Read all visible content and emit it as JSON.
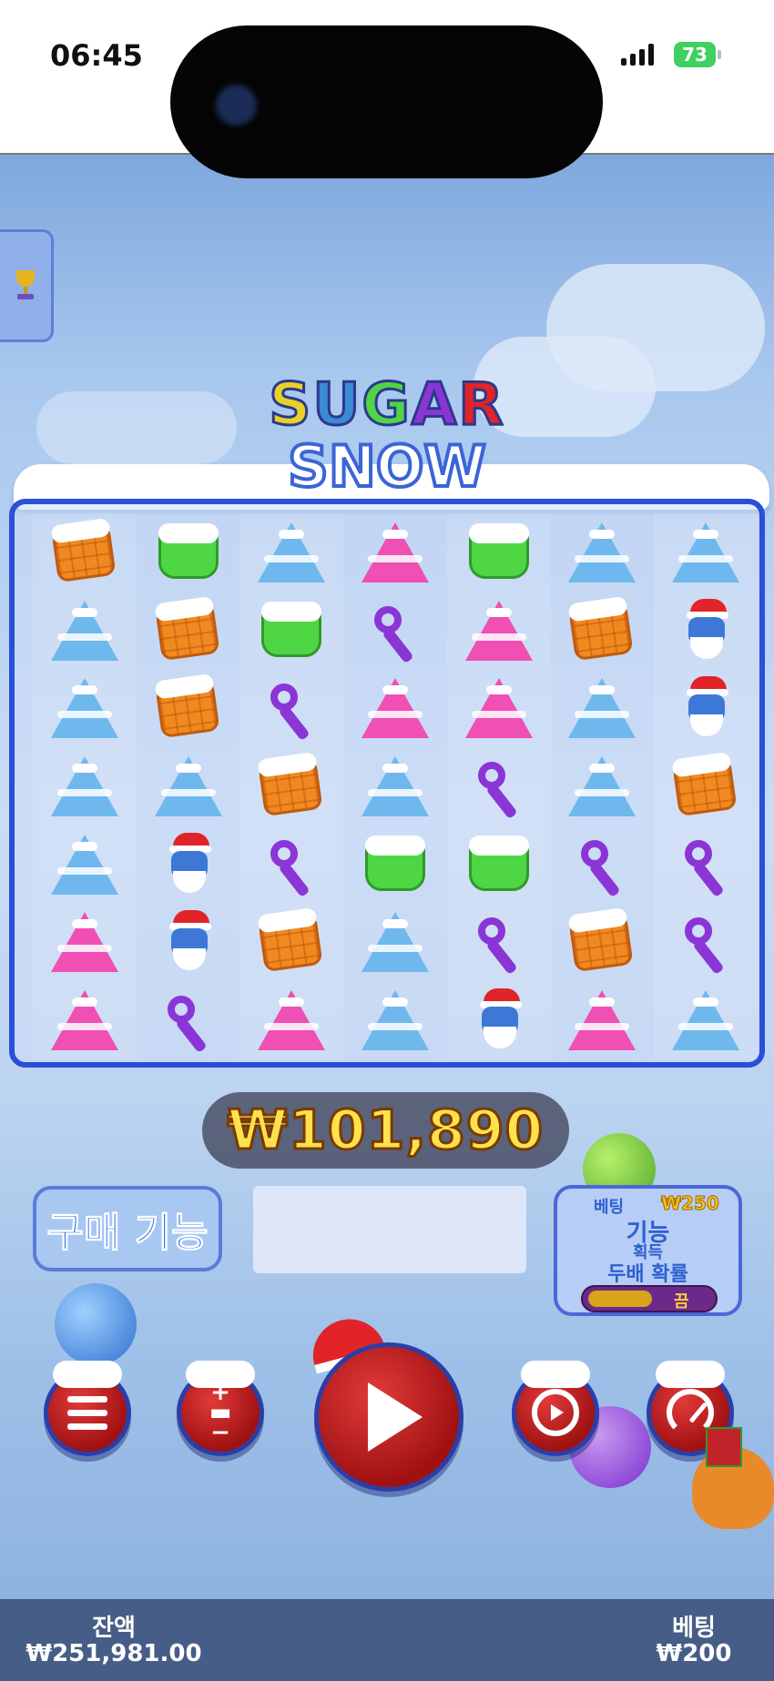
{
  "status_bar": {
    "time": "06:45",
    "battery": "73"
  },
  "game": {
    "logo_line1": "SUGAR",
    "logo_line2": "SNOW",
    "logo_colors": [
      "#e8d12a",
      "#3b8ad6",
      "#4fd645",
      "#8b35d6",
      "#e0242a"
    ],
    "grid_columns": [
      [
        "waffle",
        "tree-blue",
        "tree-blue",
        "tree-blue",
        "tree-blue",
        "tree-pink",
        "tree-pink"
      ],
      [
        "jelly",
        "waffle",
        "waffle",
        "tree-blue",
        "santa",
        "santa",
        "candy"
      ],
      [
        "tree-blue",
        "jelly",
        "candy",
        "waffle",
        "candy",
        "waffle",
        "tree-pink"
      ],
      [
        "tree-pink",
        "candy",
        "tree-pink",
        "tree-blue",
        "jelly",
        "tree-blue",
        "tree-blue"
      ],
      [
        "jelly",
        "tree-pink",
        "tree-pink",
        "candy",
        "jelly",
        "candy",
        "santa"
      ],
      [
        "tree-blue",
        "waffle",
        "tree-blue",
        "tree-blue",
        "candy",
        "waffle",
        "tree-pink"
      ],
      [
        "tree-blue",
        "santa",
        "santa",
        "waffle",
        "candy",
        "candy",
        "tree-blue"
      ]
    ],
    "symbol_colors": {
      "tree-blue": "#6fb8ee",
      "tree-pink": "#f04fb4"
    },
    "win_amount": "₩101,890",
    "buy_feature_label": "구매 기능",
    "ante": {
      "bet_label": "베팅",
      "bet_amount": "₩250",
      "line1": "기능",
      "line2": "획득",
      "line3": "두배 확률",
      "toggle_state": "끔"
    },
    "controls": {
      "menu": "menu-icon",
      "bet_adjust": "coin-stack-icon",
      "spin": "play-icon",
      "autoplay": "autoplay-icon",
      "turbo": "speedometer-icon"
    }
  },
  "footer": {
    "balance_label": "잔액",
    "balance_value": "₩251,981.00",
    "bet_label": "베팅",
    "bet_value": "₩200"
  }
}
